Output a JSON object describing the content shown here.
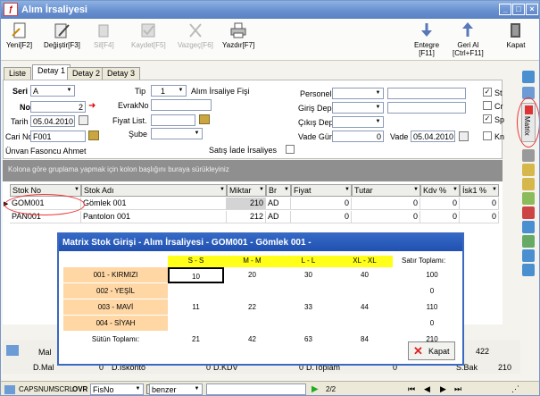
{
  "window": {
    "title": "Alım İrsaliyesi"
  },
  "toolbar": {
    "yeni": "Yeni[F2]",
    "degistir": "Değiştir[F3]",
    "sil": "Sil[F4]",
    "kaydet": "Kaydet[F5]",
    "vazgec": "Vazgeç[F6]",
    "yazdir": "Yazdır[F7]",
    "entegre_1": "Entegre",
    "entegre_2": "[F11]",
    "geri_al_1": "Geri Al",
    "geri_al_2": "[Ctrl+F11]",
    "kapat": "Kapat"
  },
  "tabs": [
    "Liste",
    "Detay 1",
    "Detay 2",
    "Detay 3"
  ],
  "form": {
    "seri_label": "Seri",
    "seri_value": "A",
    "no_label": "No",
    "no_value": "2",
    "tarih_label": "Tarih",
    "tarih_value": "05.04.2010",
    "cari_label": "Cari No",
    "cari_value": "F001",
    "unvan_label": "Ünvan",
    "unvan_value": "Fasoncu Ahmet",
    "tip_label": "Tip",
    "tip_value": "1",
    "tip_desc": "Alım İrsaliye Fişi",
    "evrak_label": "EvrakNo",
    "evrak_value": "",
    "fiyat_label": "Fiyat List.",
    "fiyat_value": "",
    "sube_label": "Şube",
    "sube_value": "",
    "satis_iade_label": "Satış İade İrsaliyes",
    "personel_label": "Personel",
    "giris_label": "Giriş Depo",
    "cikis_label": "Çıkış Depo",
    "vade_gun_label": "Vade Gün",
    "vade_gun_value": "0",
    "vade_label": "Vade",
    "vade_value": "05.04.2010",
    "st_label": "St",
    "cr_label": "Cr",
    "sp_label": "Sp",
    "kn_label": "Kn"
  },
  "groupbar": "Kolona göre gruplama yapmak için kolon başlığını buraya sürükleyiniz",
  "grid": {
    "columns": [
      "Stok No",
      "Stok Adı",
      "Miktar",
      "Br",
      "Fiyat",
      "Tutar",
      "Kdv %",
      "İsk1 %"
    ],
    "rows": [
      {
        "stok_no": "GOM001",
        "stok_adi": "Gömlek 001",
        "miktar": "210",
        "br": "AD",
        "fiyat": "0",
        "tutar": "0",
        "kdv": "0",
        "isk": "0"
      },
      {
        "stok_no": "PAN001",
        "stok_adi": "Pantolon 001",
        "miktar": "212",
        "br": "AD",
        "fiyat": "0",
        "tutar": "0",
        "kdv": "0",
        "isk": "0"
      }
    ]
  },
  "bottom": {
    "mal_label": "Mal",
    "dmal_label": "D.Mal",
    "dmal_value": "0",
    "disk_label": "D.İskonto",
    "disk_value": "0",
    "dkdv_label": "D.KDV",
    "dkdv_value": "0",
    "dtop_label": "D.Toplam",
    "dtop_value": "0",
    "sbak_label": "S.Bak",
    "sbak_value": "210",
    "right_value_1": "422"
  },
  "matrix": {
    "title": "Matrix Stok Girişi - Alım İrsaliyesi - GOM001 - Gömlek 001 -",
    "sizes": [
      "S - S",
      "M - M",
      "L - L",
      "XL - XL"
    ],
    "row_total_header": "Satır Toplamı:",
    "rows": [
      {
        "label": "001 - KIRMIZI",
        "values": [
          "10",
          "20",
          "30",
          "40"
        ],
        "total": "100"
      },
      {
        "label": "002 - YEŞİL",
        "values": [
          "",
          "",
          "",
          ""
        ],
        "total": "0"
      },
      {
        "label": "003 - MAVİ",
        "values": [
          "11",
          "22",
          "33",
          "44"
        ],
        "total": "110"
      },
      {
        "label": "004 - SİYAH",
        "values": [
          "",
          "",
          "",
          ""
        ],
        "total": "0"
      }
    ],
    "col_total_label": "Sütün Toplamı:",
    "col_totals": [
      "21",
      "42",
      "63",
      "84"
    ],
    "grand_total": "210",
    "close_label": "Kapat"
  },
  "side": {
    "matrix_label": "Matrix"
  },
  "statusbar": {
    "caps": "CAPS",
    "num": "NUM",
    "scrl": "SCRL",
    "ovr": "OVR",
    "field1": "FisNo",
    "field2": "benzer",
    "page": "2/2"
  },
  "colors": {
    "title_blue": "#5a82c4",
    "matrix_header_yellow": "#ffff1a",
    "matrix_row_orange": "#ffd7a5",
    "red_circle": "#e33333"
  }
}
